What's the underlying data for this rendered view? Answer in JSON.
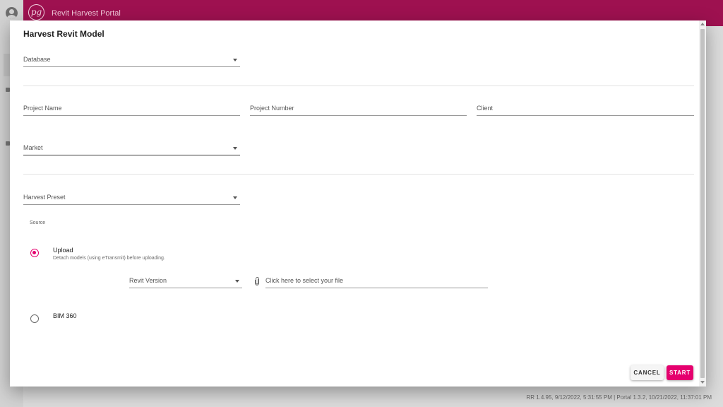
{
  "app": {
    "logo_text": "pg",
    "title": "Revit Harvest Portal",
    "footer_version": "RR 1.4.95, 9/12/2022, 5:31:55 PM | Portal 1.3.2, 10/21/2022, 11:37:01 PM"
  },
  "dialog": {
    "title": "Harvest Revit Model",
    "database_label": "Database",
    "project_name_label": "Project Name",
    "project_number_label": "Project Number",
    "client_label": "Client",
    "market_label": "Market",
    "harvest_preset_label": "Harvest Preset",
    "source_label": "Source",
    "upload_label": "Upload",
    "upload_hint": "Detach models (using eTransmit) before uploading.",
    "revit_version_label": "Revit Version",
    "file_placeholder": "Click here to select your file",
    "bim360_label": "BIM 360",
    "cancel_label": "CANCEL",
    "start_label": "START"
  },
  "colors": {
    "brand_bar": "#9e1150",
    "accent": "#e5006e"
  }
}
